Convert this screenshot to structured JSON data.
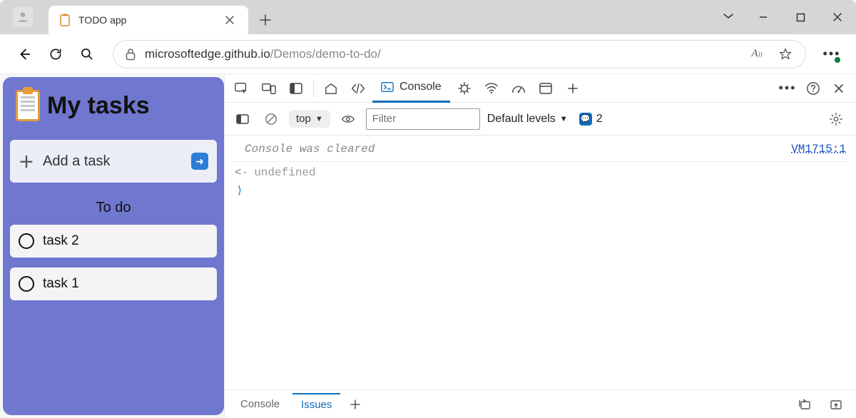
{
  "browser": {
    "tab_title": "TODO app",
    "url_prefix": "microsoftedge.github.io",
    "url_rest": "/Demos/demo-to-do/"
  },
  "page": {
    "title": "My tasks",
    "add_task_label": "Add a task",
    "section_todo": "To do",
    "tasks": [
      "task 2",
      "task 1"
    ]
  },
  "devtools": {
    "tab_console": "Console",
    "filter_context": "top",
    "filter_placeholder": "Filter",
    "levels_label": "Default levels",
    "issues_count": "2",
    "console_cleared": "Console was cleared",
    "source_ref": "VM1715:1",
    "return_value": "undefined",
    "bottom_tab_console": "Console",
    "bottom_tab_issues": "Issues"
  }
}
